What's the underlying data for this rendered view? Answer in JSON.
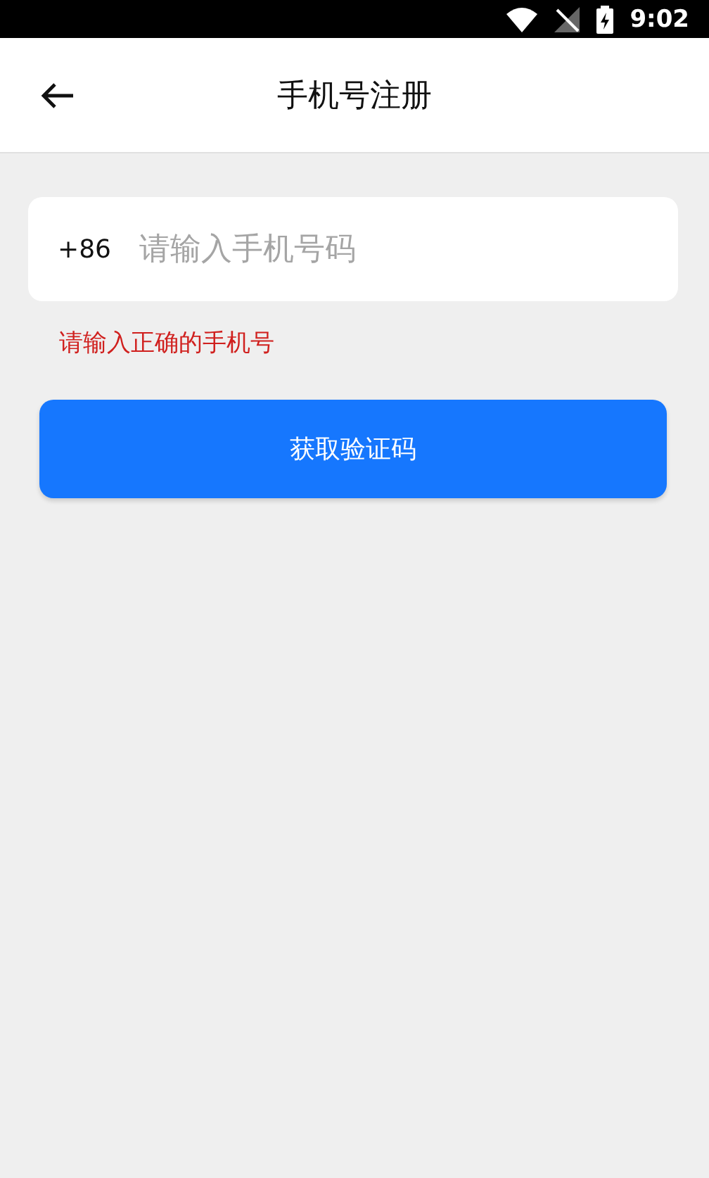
{
  "status_bar": {
    "time": "9:02"
  },
  "header": {
    "title": "手机号注册"
  },
  "phone_field": {
    "prefix": "+86",
    "placeholder": "请输入手机号码"
  },
  "error": "请输入正确的手机号",
  "buttons": [
    {
      "label": "获取验证码",
      "kind": "primary"
    }
  ]
}
